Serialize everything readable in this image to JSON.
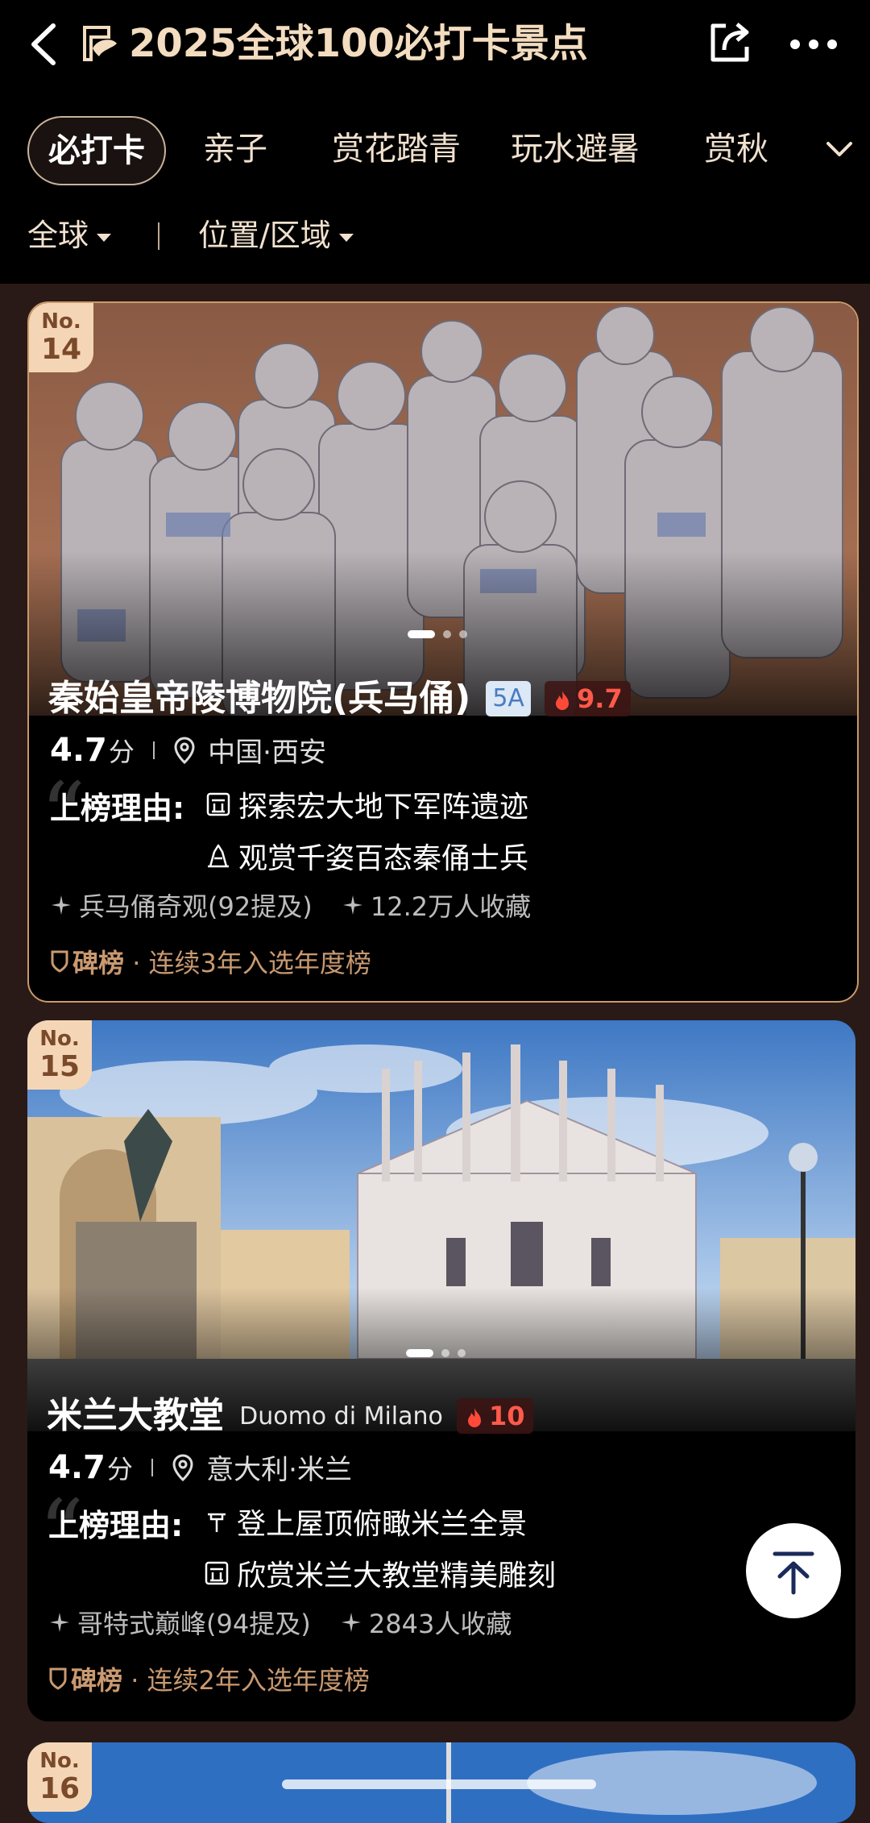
{
  "header": {
    "title": "2025全球100必打卡景点"
  },
  "tabs": [
    {
      "label": "必打卡",
      "active": true
    },
    {
      "label": "亲子",
      "active": false
    },
    {
      "label": "赏花踏青",
      "active": false
    },
    {
      "label": "玩水避暑",
      "active": false
    },
    {
      "label": "赏秋",
      "active": false
    }
  ],
  "filters": {
    "region": "全球",
    "location": "位置/区域"
  },
  "cards": [
    {
      "rank_no": "No.",
      "rank": "14",
      "name": "秦始皇帝陵博物院(兵马俑)",
      "level": "5A",
      "heat": "9.7",
      "score": "4.7",
      "score_unit": "分",
      "location": "中国·西安",
      "reason_label": "上榜理由:",
      "reasons": [
        "探索宏大地下军阵遗迹",
        "观赏千姿百态秦俑士兵"
      ],
      "tags": [
        "兵马俑奇观(92提及)",
        "12.2万人收藏"
      ],
      "board_logo": "碑榜",
      "board_text": "· 连续3年入选年度榜",
      "image_icon": "terracotta-army-photo"
    },
    {
      "rank_no": "No.",
      "rank": "15",
      "name": "米兰大教堂",
      "sub_name": "Duomo di Milano",
      "heat": "10",
      "score": "4.7",
      "score_unit": "分",
      "location": "意大利·米兰",
      "reason_label": "上榜理由:",
      "reasons": [
        "登上屋顶俯瞰米兰全景",
        "欣赏米兰大教堂精美雕刻"
      ],
      "tags": [
        "哥特式巅峰(94提及)",
        "2843人收藏"
      ],
      "board_logo": "碑榜",
      "board_text": "· 连续2年入选年度榜",
      "image_icon": "milan-cathedral-photo"
    },
    {
      "rank_no": "No.",
      "rank": "16"
    }
  ],
  "colors": {
    "background": "#2a1a17",
    "title": "#f3dcbf",
    "heat": "#ff5a4a",
    "board": "#c99970",
    "badge": "#f4d6b6"
  }
}
